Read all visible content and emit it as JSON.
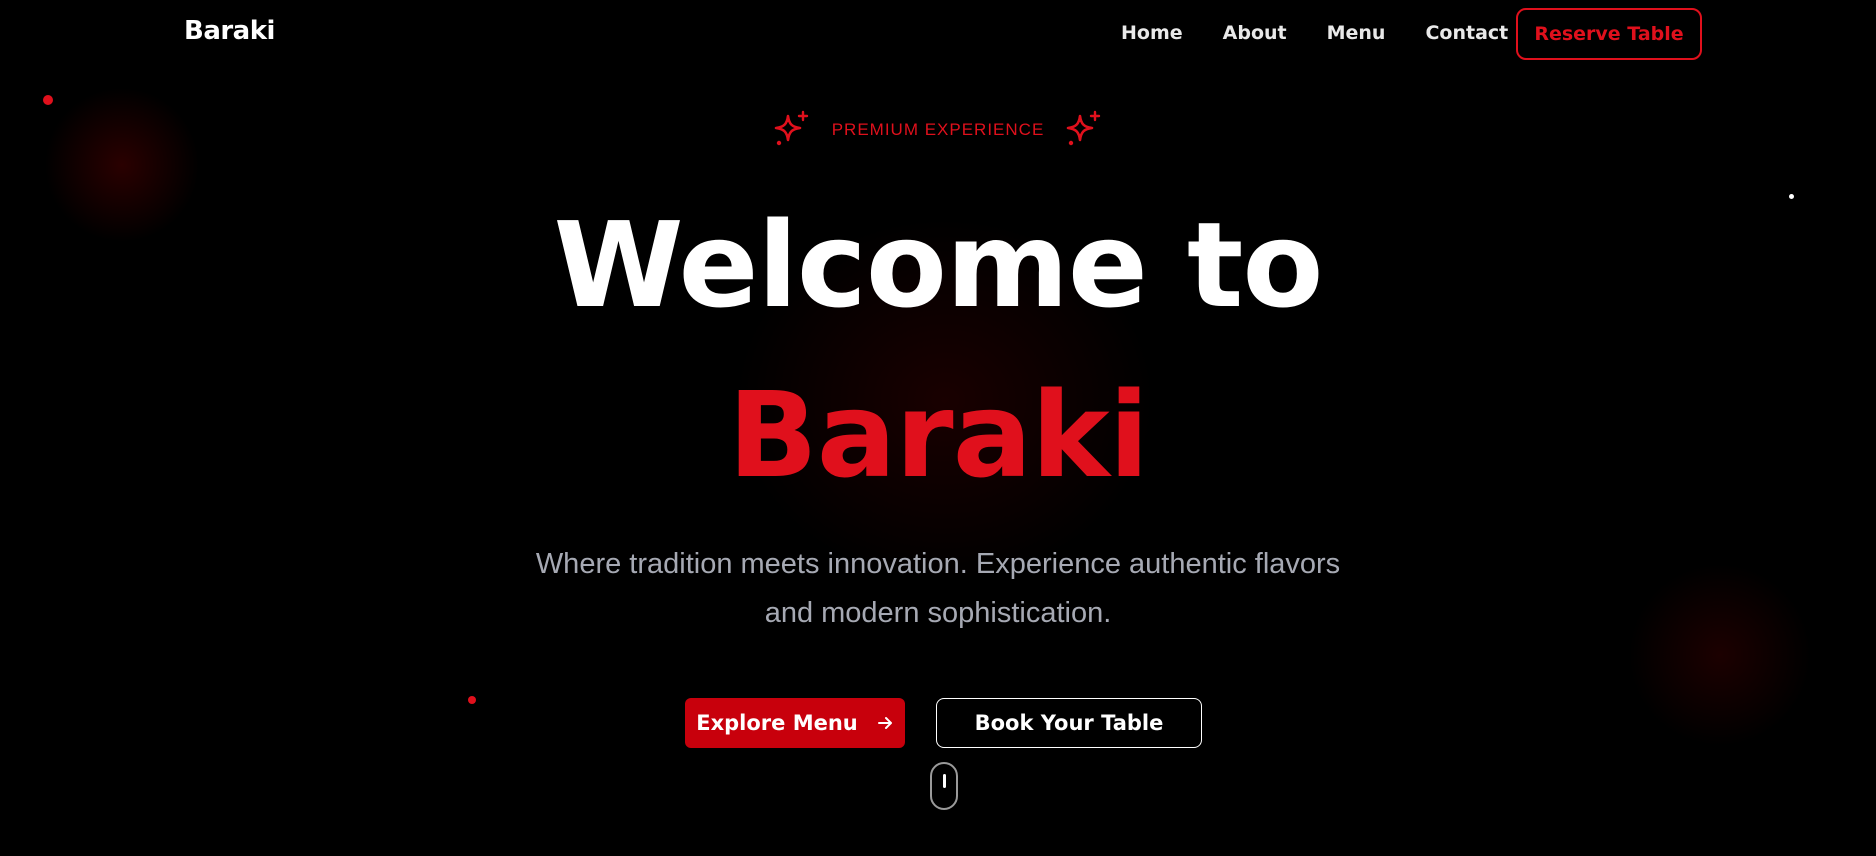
{
  "nav": {
    "logo": "Baraki",
    "links": [
      "Home",
      "About",
      "Menu",
      "Contact"
    ],
    "reserve_label": "Reserve Table"
  },
  "hero": {
    "badge": "PREMIUM EXPERIENCE",
    "headline_line1": "Welcome to",
    "headline_line2": "Baraki",
    "subtitle_line1": "Where tradition meets innovation. Experience authentic flavors",
    "subtitle_line2": "and modern sophistication.",
    "primary_button": "Explore Menu",
    "secondary_button": "Book Your Table"
  },
  "icons": {
    "badge_left": "sparkles-icon",
    "badge_right": "sparkles-icon",
    "primary_button": "arrow-right-icon",
    "scroll": "mouse-scroll-icon"
  },
  "colors": {
    "accent": "#e0101c",
    "background": "#000000",
    "text": "#ffffff",
    "muted": "#a6a9b3"
  }
}
